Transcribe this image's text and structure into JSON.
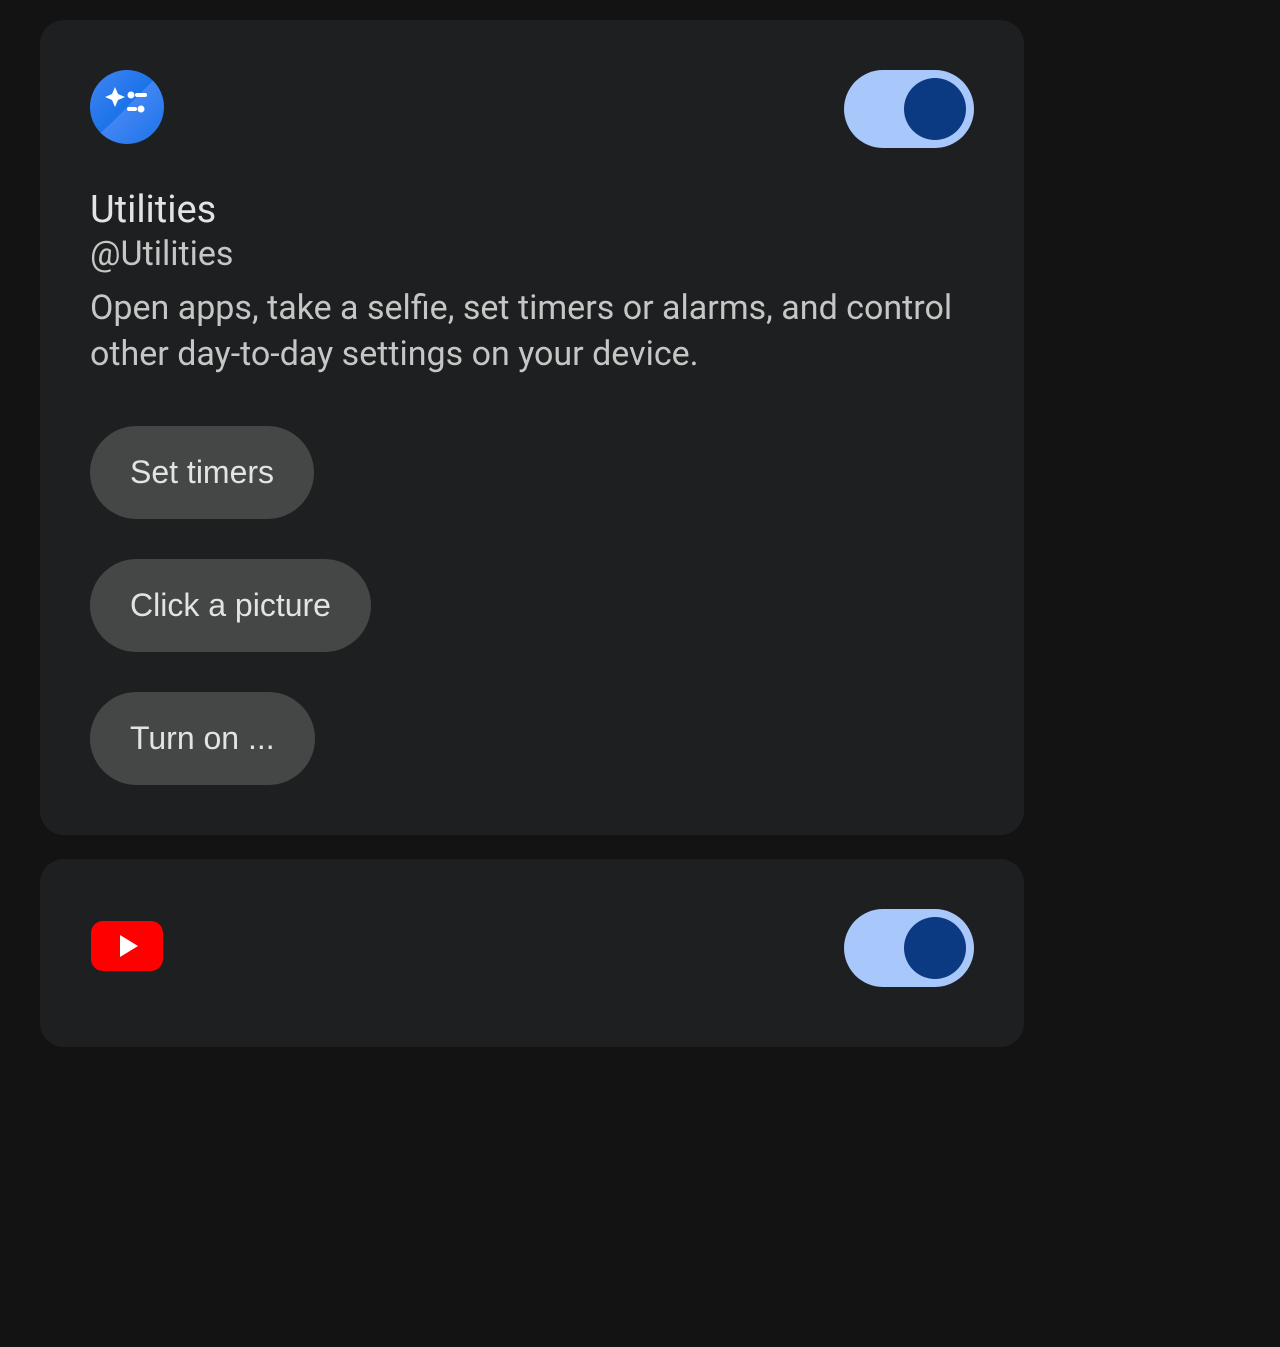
{
  "cards": {
    "utilities": {
      "title": "Utilities",
      "handle": "@Utilities",
      "description": "Open apps, take a selfie, set timers or alarms, and control other day-to-day settings on your device.",
      "toggleOn": true,
      "chips": [
        "Set timers",
        "Click a picture",
        "Turn on ..."
      ]
    },
    "youtube": {
      "toggleOn": true
    }
  },
  "colors": {
    "cardBg": "#1e1f20",
    "bodyBg": "#131314",
    "toggleTrack": "#a8c7fa",
    "toggleKnob": "#0b3a82",
    "chipBg": "#444746",
    "youtubeRed": "#ff0000"
  }
}
